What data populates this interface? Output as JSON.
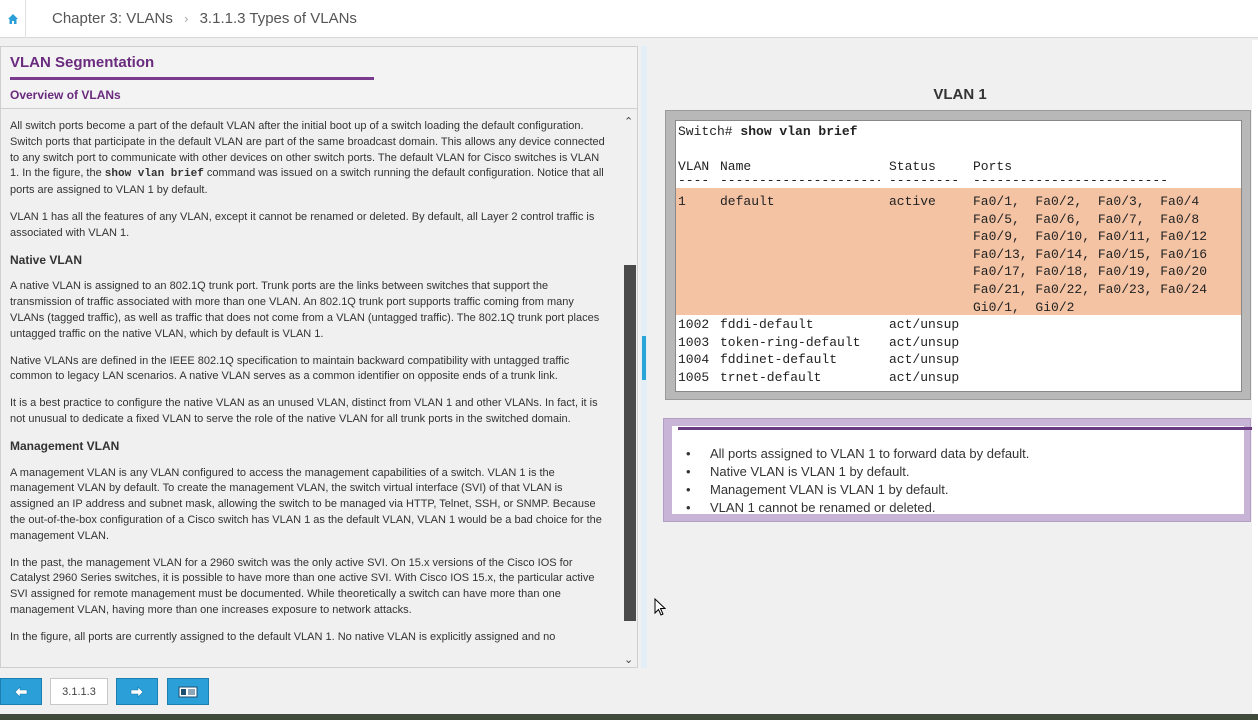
{
  "breadcrumb": {
    "chapter": "Chapter 3: VLANs",
    "section": "3.1.1.3 Types of VLANs"
  },
  "left": {
    "title": "VLAN Segmentation",
    "subtitle": "Overview of VLANs",
    "p1_a": "All switch ports become a part of the default VLAN after the initial boot up of a switch loading the default configuration. Switch ports that participate in the default VLAN are part of the same broadcast domain. This allows any device connected to any switch port to communicate with other devices on other switch ports. The default VLAN for Cisco switches is VLAN 1. In the figure, the ",
    "p1_code": "show vlan brief",
    "p1_b": " command was issued on a switch running the default configuration. Notice that all ports are assigned to VLAN 1 by default.",
    "p2": "VLAN 1 has all the features of any VLAN, except it cannot be renamed or deleted. By default, all Layer 2 control traffic is associated with VLAN 1.",
    "h_native": "Native VLAN",
    "p3": "A native VLAN is assigned to an 802.1Q trunk port. Trunk ports are the links between switches that support the transmission of traffic associated with more than one VLAN. An 802.1Q trunk port supports traffic coming from many VLANs (tagged traffic), as well as traffic that does not come from a VLAN (untagged traffic). The 802.1Q trunk port places untagged traffic on the native VLAN, which by default is VLAN 1.",
    "p4": "Native VLANs are defined in the IEEE 802.1Q specification to maintain backward compatibility with untagged traffic common to legacy LAN scenarios. A native VLAN serves as a common identifier on opposite ends of a trunk link.",
    "p5": "It is a best practice to configure the native VLAN as an unused VLAN, distinct from VLAN 1 and other VLANs. In fact, it is not unusual to dedicate a fixed VLAN to serve the role of the native VLAN for all trunk ports in the switched domain.",
    "h_mgmt": "Management VLAN",
    "p6": "A management VLAN is any VLAN configured to access the management capabilities of a switch. VLAN 1 is the management VLAN by default. To create the management VLAN, the switch virtual interface (SVI) of that VLAN is assigned an IP address and subnet mask, allowing the switch to be managed via HTTP, Telnet, SSH, or SNMP. Because the out-of-the-box configuration of a Cisco switch has VLAN 1 as the default VLAN, VLAN 1 would be a bad choice for the management VLAN.",
    "p7": "In the past, the management VLAN for a 2960 switch was the only active SVI. On 15.x versions of the Cisco IOS for Catalyst 2960 Series switches, it is possible to have more than one active SVI. With Cisco IOS 15.x, the particular active SVI assigned for remote management must be documented. While theoretically a switch can have more than one management VLAN, having more than one increases exposure to network attacks.",
    "p8": "In the figure, all ports are currently assigned to the default VLAN 1. No native VLAN is explicitly assigned and no"
  },
  "figure": {
    "title": "VLAN 1",
    "prompt": "Switch# ",
    "command": "show vlan brief",
    "headers": {
      "vlan": "VLAN",
      "name": "Name",
      "status": "Status",
      "ports": "Ports"
    },
    "dashes": {
      "vlan": "----",
      "name": "--------------------------------",
      "status": "---------",
      "ports": "-------------------------------"
    },
    "default_row": {
      "vlan": "1",
      "name": "default",
      "status": "active",
      "ports": [
        "Fa0/1,  Fa0/2,  Fa0/3,  Fa0/4",
        "Fa0/5,  Fa0/6,  Fa0/7,  Fa0/8",
        "Fa0/9,  Fa0/10, Fa0/11, Fa0/12",
        "Fa0/13, Fa0/14, Fa0/15, Fa0/16",
        "Fa0/17, Fa0/18, Fa0/19, Fa0/20",
        "Fa0/21, Fa0/22, Fa0/23, Fa0/24",
        "Gi0/1,  Gi0/2"
      ]
    },
    "other_rows": [
      {
        "vlan": "1002",
        "name": "fddi-default",
        "status": "act/unsup"
      },
      {
        "vlan": "1003",
        "name": "token-ring-default",
        "status": "act/unsup"
      },
      {
        "vlan": "1004",
        "name": "fddinet-default",
        "status": "act/unsup"
      },
      {
        "vlan": "1005",
        "name": "trnet-default",
        "status": "act/unsup"
      }
    ],
    "highlight_color": "#f3c3a4"
  },
  "notes": [
    "All ports assigned to VLAN 1 to forward data by default.",
    "Native VLAN is VLAN 1 by default.",
    "Management VLAN is VLAN 1 by default.",
    "VLAN 1 cannot be renamed or deleted."
  ],
  "nav": {
    "page": "3.1.1.3",
    "prev_icon": "arrow-left-icon",
    "next_icon": "arrow-right-icon",
    "toc_icon": "toc-icon"
  },
  "colors": {
    "accent_purple": "#6a2a7e",
    "nav_blue": "#2a9fd8"
  }
}
